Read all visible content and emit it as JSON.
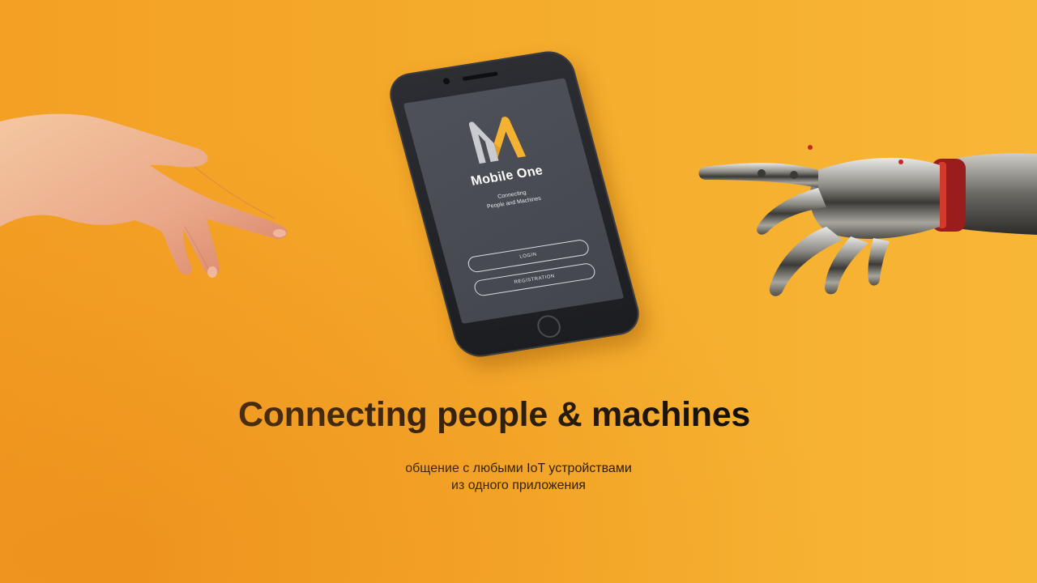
{
  "phone_app": {
    "logo_letter": "M",
    "app_name": "Mobile One",
    "tagline_line1": "Connecting",
    "tagline_line2": "People and Machines",
    "login_label": "LOGIN",
    "registration_label": "REGISTRATION"
  },
  "headline": "Connecting people & machines",
  "subheadline": {
    "line1": "общение с любыми IoT устройствами",
    "line2": "из одного приложения"
  },
  "colors": {
    "background": "#f5ab2a",
    "phone_body": "#1f2024",
    "screen": "#4a4d55",
    "logo_yellow": "#f4b233",
    "logo_gray": "#c9cbd1",
    "text": "#0c0c0c"
  }
}
